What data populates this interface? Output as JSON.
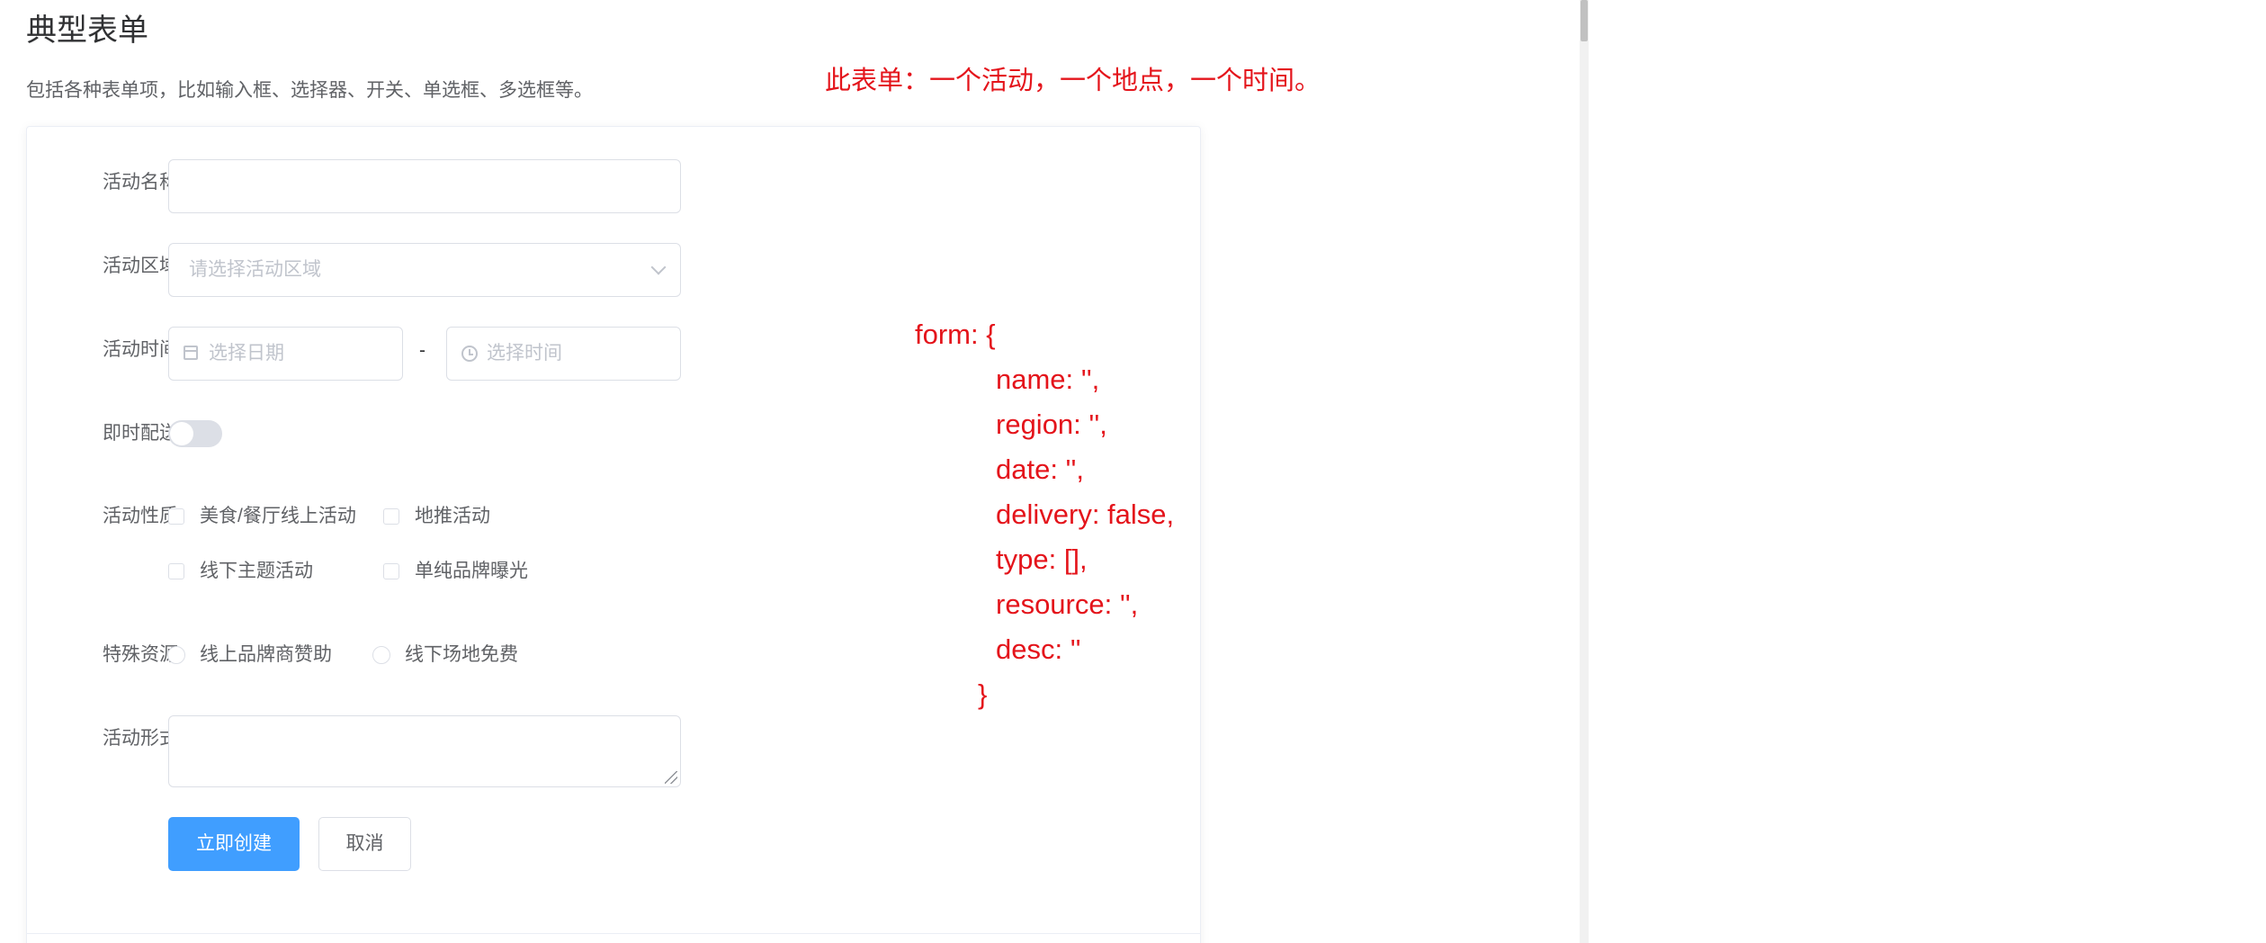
{
  "page": {
    "title": "典型表单",
    "description": "包括各种表单项，比如输入框、选择器、开关、单选框、多选框等。"
  },
  "form": {
    "name": {
      "label": "活动名称",
      "value": ""
    },
    "region": {
      "label": "活动区域",
      "placeholder": "请选择活动区域"
    },
    "time": {
      "label": "活动时间",
      "date_placeholder": "选择日期",
      "separator": "-",
      "time_placeholder": "选择时间"
    },
    "delivery": {
      "label": "即时配送",
      "checked": false
    },
    "type": {
      "label": "活动性质",
      "options": [
        "美食/餐厅线上活动",
        "地推活动",
        "线下主题活动",
        "单纯品牌曝光"
      ]
    },
    "resource": {
      "label": "特殊资源",
      "options": [
        "线上品牌商赞助",
        "线下场地免费"
      ]
    },
    "desc": {
      "label": "活动形式",
      "value": ""
    },
    "buttons": {
      "submit": "立即创建",
      "cancel": "取消"
    }
  },
  "annotation": {
    "note": "此表单：一个活动，一个地点，一个时间。",
    "code_lines": [
      "form: {",
      "name: '',",
      "region: '',",
      "date: '',",
      "delivery: false,",
      "type: [],",
      "resource: '',",
      "desc: ''",
      "}"
    ],
    "color": "#e4141b"
  },
  "colors": {
    "primary": "#409eff",
    "border": "#dcdfe6",
    "placeholder": "#c0c4cc",
    "title": "#303133",
    "text": "#606266"
  },
  "icons": {
    "select": "chevron-down-icon",
    "date": "calendar-icon",
    "time": "clock-icon"
  }
}
